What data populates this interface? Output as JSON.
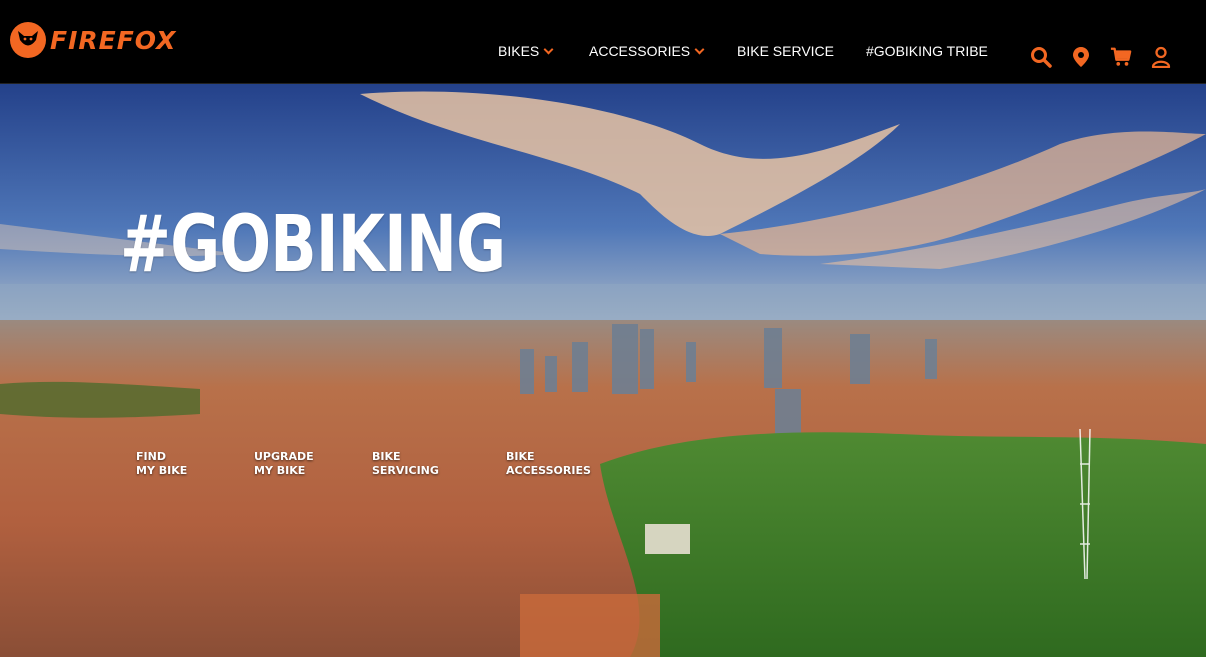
{
  "header": {
    "logo_text": "FIREFOX",
    "nav": [
      {
        "label": "BIKES",
        "has_dropdown": true
      },
      {
        "label": "ACCESSORIES",
        "has_dropdown": true
      },
      {
        "label": "BIKE SERVICE",
        "has_dropdown": false
      },
      {
        "label": "#GOBIKING TRIBE",
        "has_dropdown": false
      }
    ],
    "icons": [
      "search-icon",
      "location-pin-icon",
      "cart-icon",
      "user-icon"
    ],
    "accent_color": "#f26722"
  },
  "hero": {
    "title": "#GOBIKING",
    "quick_links": [
      {
        "line1": "FIND",
        "line2": "MY BIKE"
      },
      {
        "line1": "UPGRADE",
        "line2": "MY BIKE"
      },
      {
        "line1": "BIKE",
        "line2": "SERVICING"
      },
      {
        "line1": "BIKE",
        "line2": "ACCESSORIES"
      }
    ]
  }
}
